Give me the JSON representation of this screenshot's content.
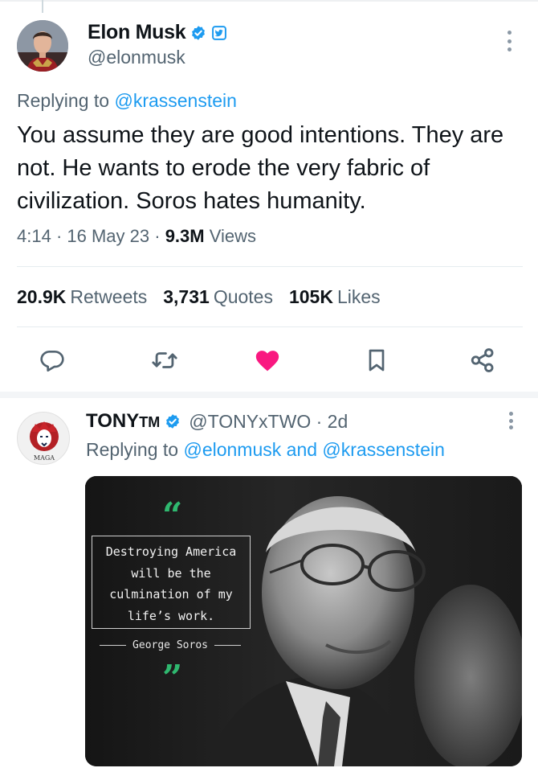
{
  "colors": {
    "link": "#1d9bf0",
    "secondary_text": "#536471",
    "primary_text": "#0f1419",
    "like_active": "#f91880",
    "quote_marks": "#2fb86f"
  },
  "main_tweet": {
    "author_name": "Elon Musk",
    "handle": "@elonmusk",
    "badges": [
      "verified-check-icon",
      "affiliate-twitter-square-icon"
    ],
    "replying_prefix": "Replying to",
    "replying_to": "@krassenstein",
    "text": "You assume they are good intentions. They are not. He wants to erode the very fabric of civilization. Soros hates humanity.",
    "time": "4:14",
    "date": "16 May 23",
    "views_count": "9.3M",
    "views_label": "Views",
    "stats": {
      "retweets_count": "20.9K",
      "retweets_label": "Retweets",
      "quotes_count": "3,731",
      "quotes_label": "Quotes",
      "likes_count": "105K",
      "likes_label": "Likes"
    },
    "actions": [
      "reply-icon",
      "retweet-icon",
      "like-icon",
      "bookmark-icon",
      "share-icon"
    ],
    "liked": true
  },
  "reply_tweet": {
    "author_name": "TONY",
    "author_suffix": "TM",
    "handle": "@TONYxTWO",
    "age": "2d",
    "replying_prefix": "Replying to",
    "replying_to_1": "@elonmusk",
    "replying_and": "and",
    "replying_to_2": "@krassenstein",
    "avatar_text": "MAGA",
    "media": {
      "quote_open": "“",
      "quote_lines": [
        "Destroying America",
        "will be the",
        "culmination of my",
        "life’s work."
      ],
      "quote_author": "George Soros",
      "quote_close": "”"
    }
  }
}
